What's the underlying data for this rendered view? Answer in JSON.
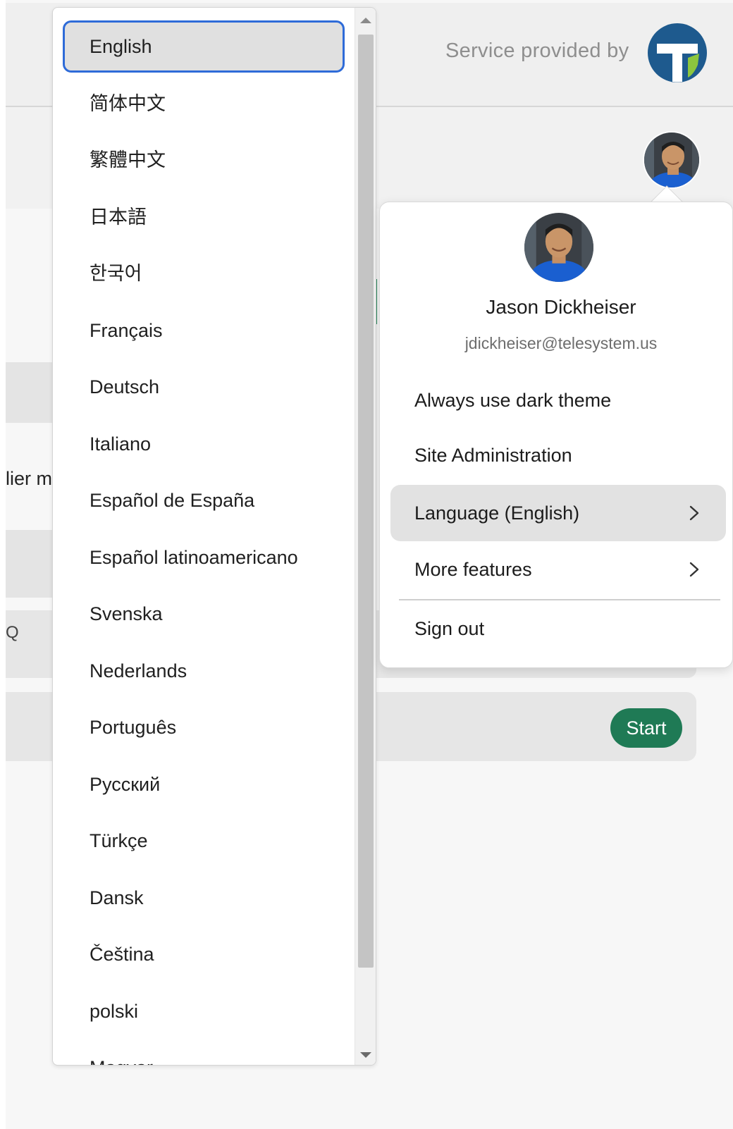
{
  "header": {
    "service_text": "Service provided by",
    "brand_colors": {
      "primary": "#1e5a8e",
      "accent": "#8cc63e"
    }
  },
  "background": {
    "clipped_text": "lier m",
    "clipped_glyph": "Q",
    "start_label": "Start",
    "start_color": "#1f7a55"
  },
  "language_dropdown": {
    "selected": "English",
    "items": [
      "English",
      "简体中文",
      "繁體中文",
      "日本語",
      "한국어",
      "Français",
      "Deutsch",
      "Italiano",
      "Español de España",
      "Español latinoamericano",
      "Svenska",
      "Nederlands",
      "Português",
      "Русский",
      "Türkçe",
      "Dansk",
      "Čeština",
      "polski",
      "Magyar"
    ]
  },
  "profile": {
    "name": "Jason Dickheiser",
    "email": "jdickheiser@telesystem.us",
    "menu": [
      {
        "label": "Always use dark theme",
        "has_chevron": false
      },
      {
        "label": "Site Administration",
        "has_chevron": false
      },
      {
        "label": "Language (English)",
        "has_chevron": true,
        "active": true
      },
      {
        "label": "More features",
        "has_chevron": true
      },
      {
        "label": "Sign out",
        "has_chevron": false
      }
    ]
  }
}
